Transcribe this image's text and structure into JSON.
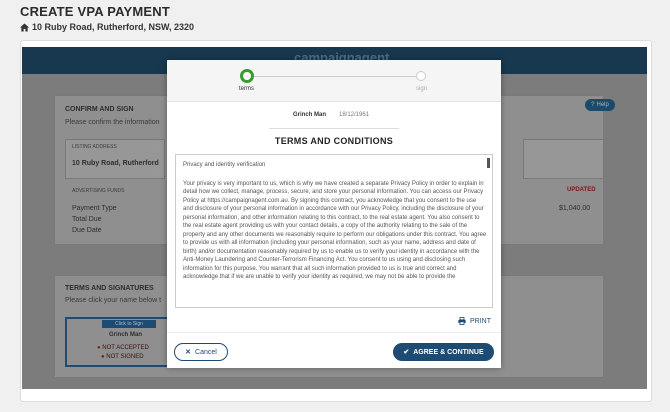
{
  "page": {
    "title": "CREATE VPA PAYMENT",
    "address": "10 Ruby Road, Rutherford, NSW, 2320"
  },
  "app": {
    "logo_text": "campaignagent",
    "help_label": "Help",
    "confirm_section": {
      "title": "CONFIRM AND SIGN",
      "subtitle": "Please confirm the information",
      "listing_label": "LISTING ADDRESS",
      "listing_value": "10 Ruby Road, Rutherford",
      "funds_label": "ADVERTISING FUNDS",
      "updated_label": "UPDATED",
      "rows": [
        {
          "label": "Payment Type"
        },
        {
          "label": "Total Due"
        },
        {
          "label": "Due Date"
        }
      ],
      "amount": "$1,040.00"
    },
    "signatures_section": {
      "title": "TERMS AND SIGNATURES",
      "subtitle": "Please click your name below t",
      "click_to_sign": "Click to Sign",
      "signer": "Grinch Man",
      "status_accepted": "NOT ACCEPTED",
      "status_signed": "NOT SIGNED"
    }
  },
  "modal": {
    "steps": [
      {
        "label": "terms",
        "active": true
      },
      {
        "label": "sign",
        "active": false
      }
    ],
    "signer_name": "Grinch Man",
    "signer_dob": "18/12/1961",
    "title": "TERMS AND CONDITIONS",
    "terms_heading": "Privacy and identity verification",
    "terms_body": "Your privacy is very important to us, which is why we have created a separate Privacy Policy in order to explain in detail how we collect, manage, process, secure, and store your personal information. You can access our Privacy Policy at https://campaignagent.com.au. By signing this contract, you acknowledge that you consent to the use and disclosure of your personal information in accordance with our Privacy Policy, including the disclosure of your personal information, and other information relating to this contract, to the real estate agent. You also consent to the real estate agent providing us with your contact details, a copy of the authority relating to the sale of the property and any other documents we reasonably require to perform our obligations under this contract. You agree to provide us with all information (including your personal information, such as your name, address and date of birth) and/or documentation reasonably required by us to enable us to verify your identity in accordance with the Anti-Money Laundering and Counter-Terrorism Financing Act. You consent to us using and disclosing such information for this purpose. You warrant that all such information provided to us is true and correct and acknowledge that if we are unable to verify your identity as required, we may not be able to provide the",
    "print_label": "PRINT",
    "cancel_label": "Cancel",
    "agree_label": "AGREE & CONTINUE"
  },
  "colors": {
    "brand_navy": "#1e4b73",
    "step_active_green": "#3a9a2e",
    "updated_red": "#c0392b"
  }
}
